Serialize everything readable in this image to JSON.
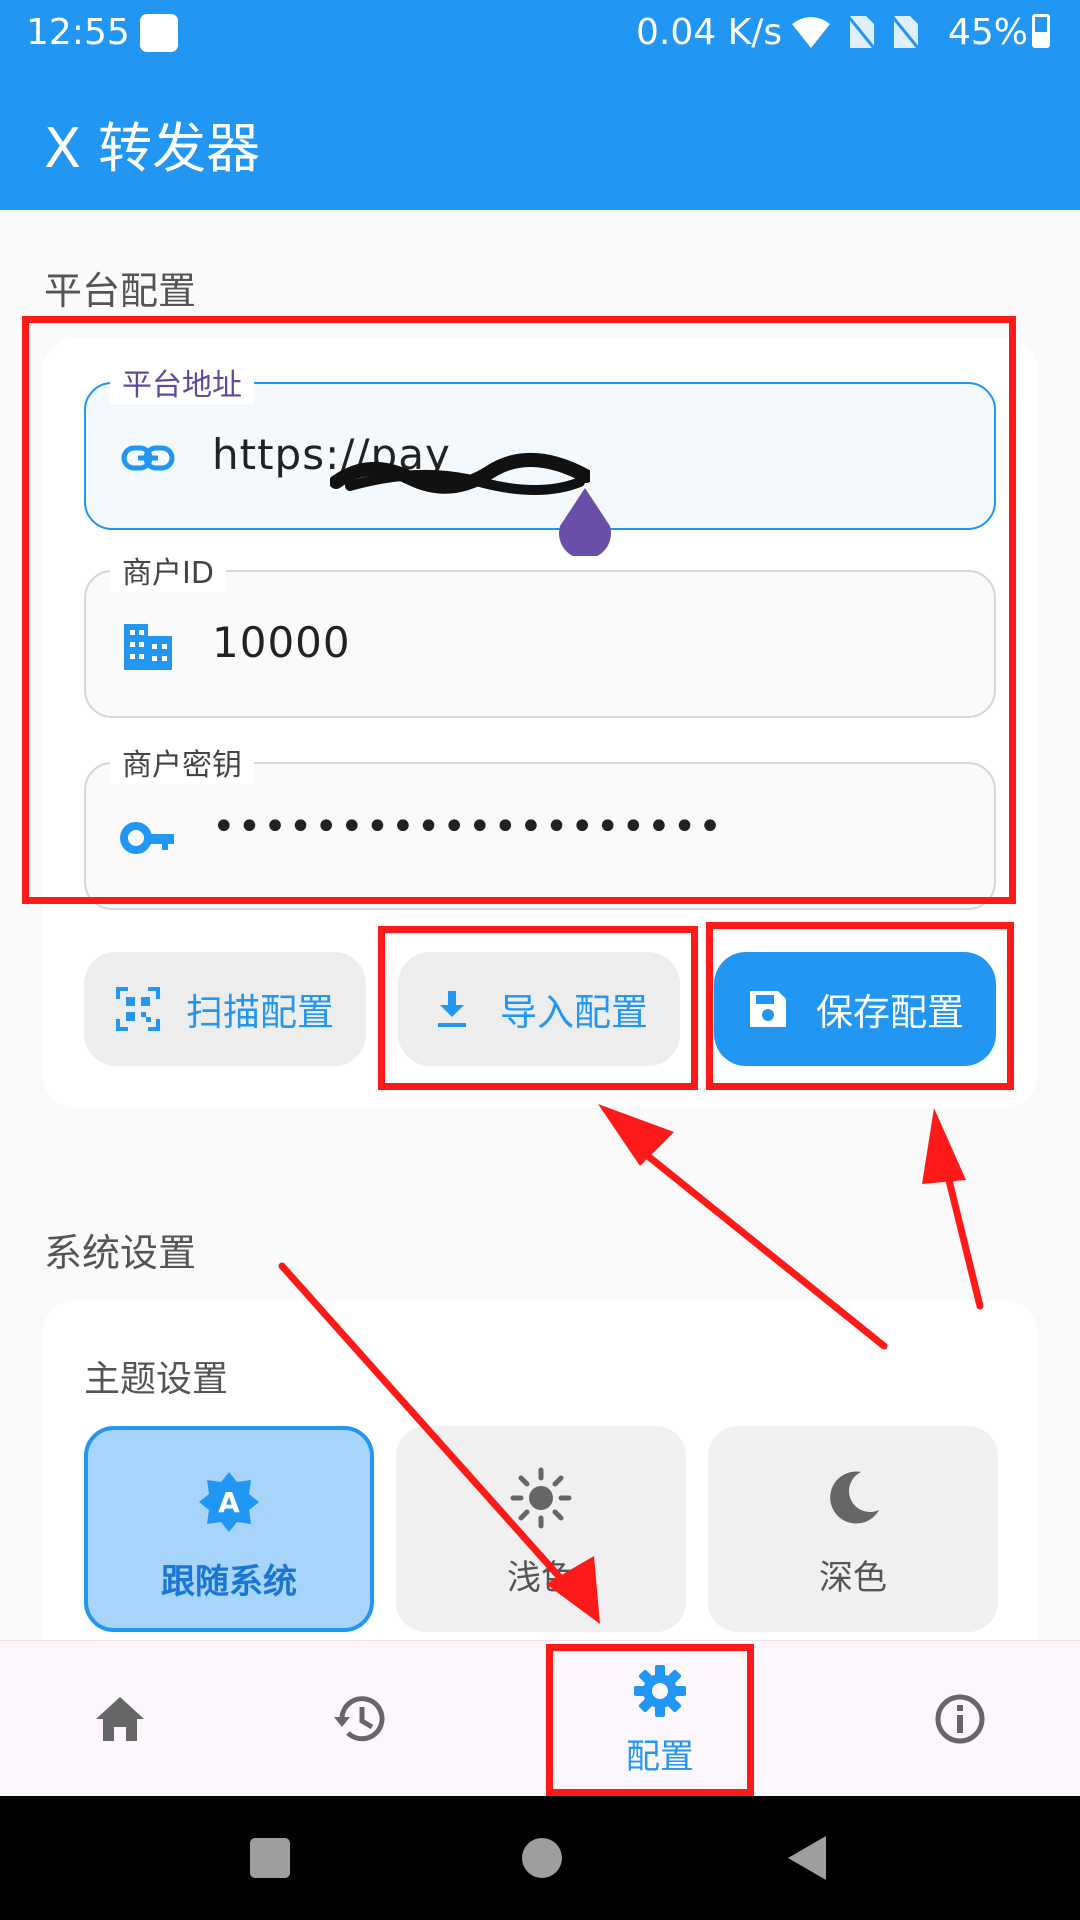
{
  "status_bar": {
    "time": "12:55",
    "net_speed": "0.04 K/s",
    "battery": "45%"
  },
  "app": {
    "title": "X 转发器"
  },
  "platform_section": {
    "title": "平台配置",
    "fields": [
      {
        "label": "平台地址",
        "value": "https://pay",
        "icon": "link-icon"
      },
      {
        "label": "商户ID",
        "value": "10000",
        "icon": "business-icon"
      },
      {
        "label": "商户密钥",
        "value": "••••••••••••••••••••",
        "icon": "key-icon"
      }
    ],
    "buttons": {
      "scan": "扫描配置",
      "import": "导入配置",
      "save": "保存配置"
    }
  },
  "system_section": {
    "title": "系统设置",
    "theme_title": "主题设置",
    "themes": [
      {
        "label": "跟随系统",
        "icon": "auto-theme-icon",
        "selected": true
      },
      {
        "label": "浅色",
        "icon": "sun-icon",
        "selected": false
      },
      {
        "label": "深色",
        "icon": "moon-icon",
        "selected": false
      }
    ]
  },
  "bottom_nav": {
    "items": [
      {
        "icon": "home-icon"
      },
      {
        "icon": "history-icon"
      },
      {
        "icon": "gear-icon",
        "label": "配置",
        "active": true
      },
      {
        "icon": "info-icon"
      }
    ]
  },
  "colors": {
    "primary": "#2196f3",
    "annotation_red": "#ff1a1a",
    "selected_theme_bg": "#a6d4fa"
  }
}
